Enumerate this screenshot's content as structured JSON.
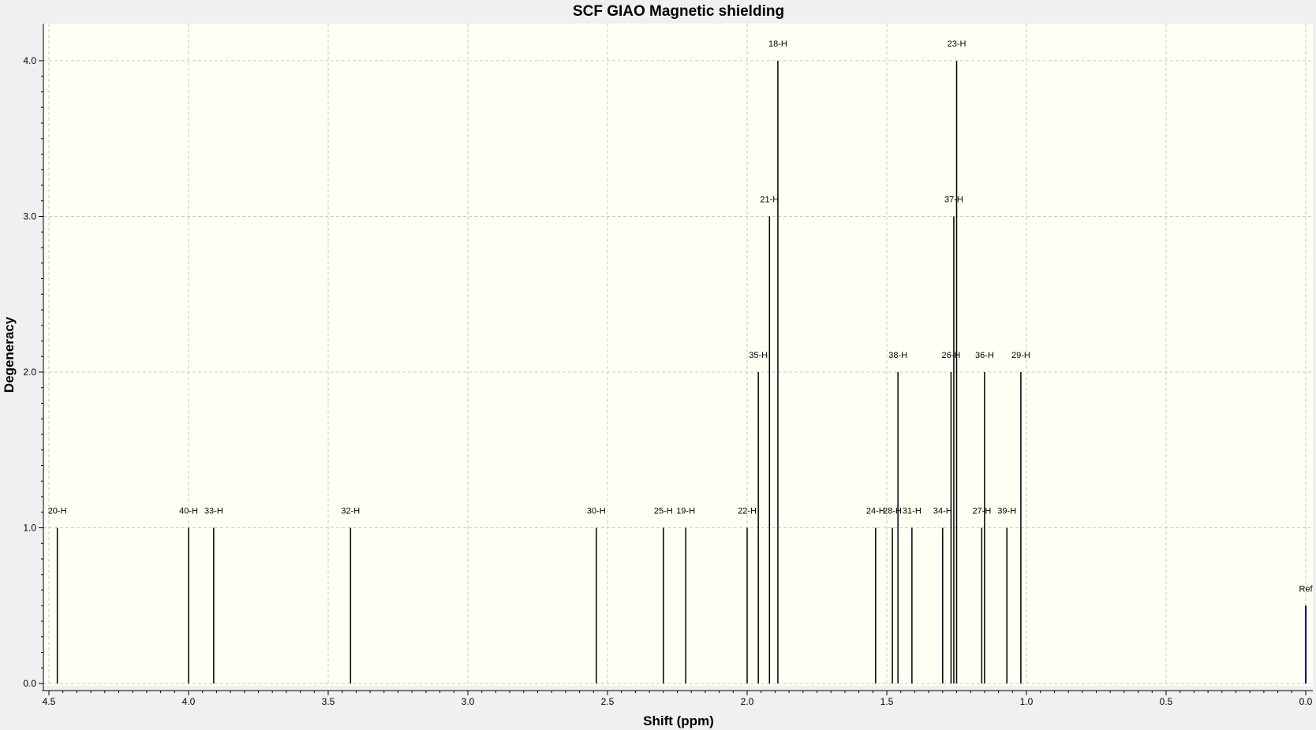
{
  "chart_data": {
    "type": "stick",
    "title": "SCF GIAO Magnetic shielding",
    "xlabel": "Shift (ppm)",
    "ylabel": "Degeneracy",
    "xlim": [
      4.5,
      0.0
    ],
    "ylim": [
      0.0,
      4.0
    ],
    "x_reversed": true,
    "grid": true,
    "x_ticks": [
      {
        "value": 4.5,
        "label": "4.5"
      },
      {
        "value": 4.0,
        "label": "4.0"
      },
      {
        "value": 3.5,
        "label": "3.5"
      },
      {
        "value": 3.0,
        "label": "3.0"
      },
      {
        "value": 2.5,
        "label": "2.5"
      },
      {
        "value": 2.0,
        "label": "2.0"
      },
      {
        "value": 1.5,
        "label": "1.5"
      },
      {
        "value": 1.0,
        "label": "1.0"
      },
      {
        "value": 0.5,
        "label": "0.5"
      },
      {
        "value": 0.0,
        "label": "0.0"
      }
    ],
    "y_ticks": [
      {
        "value": 0.0,
        "label": "0.0"
      },
      {
        "value": 1.0,
        "label": "1.0"
      },
      {
        "value": 2.0,
        "label": "2.0"
      },
      {
        "value": 3.0,
        "label": "3.0"
      },
      {
        "value": 4.0,
        "label": "4.0"
      }
    ],
    "peaks": [
      {
        "label": "20-H",
        "x": 4.47,
        "y": 1
      },
      {
        "label": "40-H",
        "x": 4.0,
        "y": 1
      },
      {
        "label": "33-H",
        "x": 3.91,
        "y": 1
      },
      {
        "label": "32-H",
        "x": 3.42,
        "y": 1
      },
      {
        "label": "30-H",
        "x": 2.54,
        "y": 1
      },
      {
        "label": "25-H",
        "x": 2.3,
        "y": 1
      },
      {
        "label": "19-H",
        "x": 2.22,
        "y": 1
      },
      {
        "label": "22-H",
        "x": 2.0,
        "y": 1
      },
      {
        "label": "35-H",
        "x": 1.96,
        "y": 2
      },
      {
        "label": "21-H",
        "x": 1.92,
        "y": 3
      },
      {
        "label": "18-H",
        "x": 1.89,
        "y": 4
      },
      {
        "label": "24-H",
        "x": 1.54,
        "y": 1
      },
      {
        "label": "28-H",
        "x": 1.48,
        "y": 1
      },
      {
        "label": "38-H",
        "x": 1.46,
        "y": 2
      },
      {
        "label": "31-H",
        "x": 1.41,
        "y": 1
      },
      {
        "label": "34-H",
        "x": 1.3,
        "y": 1
      },
      {
        "label": "26-H",
        "x": 1.27,
        "y": 2
      },
      {
        "label": "37-H",
        "x": 1.26,
        "y": 3
      },
      {
        "label": "23-H",
        "x": 1.25,
        "y": 4
      },
      {
        "label": "27-H",
        "x": 1.16,
        "y": 1
      },
      {
        "label": "36-H",
        "x": 1.15,
        "y": 2
      },
      {
        "label": "39-H",
        "x": 1.07,
        "y": 1
      },
      {
        "label": "29-H",
        "x": 1.02,
        "y": 2
      },
      {
        "label": "Ref",
        "x": 0.0,
        "y": 0.5
      }
    ],
    "colors": {
      "figure_background": "#f0f0f0",
      "plot_background": "#fffff4",
      "grid": "#c8c8c8",
      "peak": "#000000",
      "reference_peak": "#00008b",
      "axis": "#000000"
    }
  }
}
